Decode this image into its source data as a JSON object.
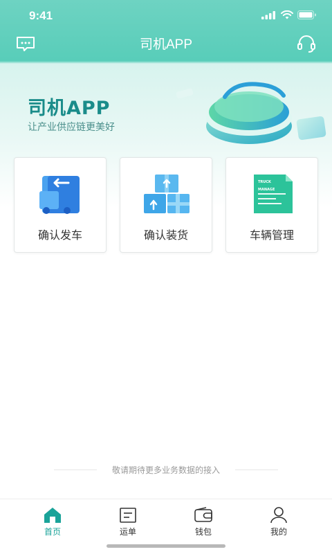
{
  "status_bar": {
    "time": "9:41"
  },
  "nav": {
    "title": "司机APP",
    "left_icon": "chat-icon",
    "right_icon": "headset-icon"
  },
  "hero": {
    "title": "司机APP",
    "subtitle": "让产业供应链更美好"
  },
  "cards": [
    {
      "label": "确认发车",
      "icon": "truck-depart-icon"
    },
    {
      "label": "确认装货",
      "icon": "cargo-boxes-icon"
    },
    {
      "label": "车辆管理",
      "icon": "truck-manage-doc-icon",
      "doc_text": [
        "TRUCK",
        "MANAGE"
      ]
    }
  ],
  "footer": {
    "note": "敬请期待更多业务数据的接入"
  },
  "tabbar": {
    "active_color": "#1aa399",
    "items": [
      {
        "label": "首页",
        "icon": "home-icon",
        "active": true
      },
      {
        "label": "运单",
        "icon": "waybill-icon",
        "active": false
      },
      {
        "label": "钱包",
        "icon": "wallet-icon",
        "active": false
      },
      {
        "label": "我的",
        "icon": "profile-icon",
        "active": false
      }
    ]
  },
  "colors": {
    "brand": "#1a8c8a",
    "header": "#5ccfbb"
  }
}
